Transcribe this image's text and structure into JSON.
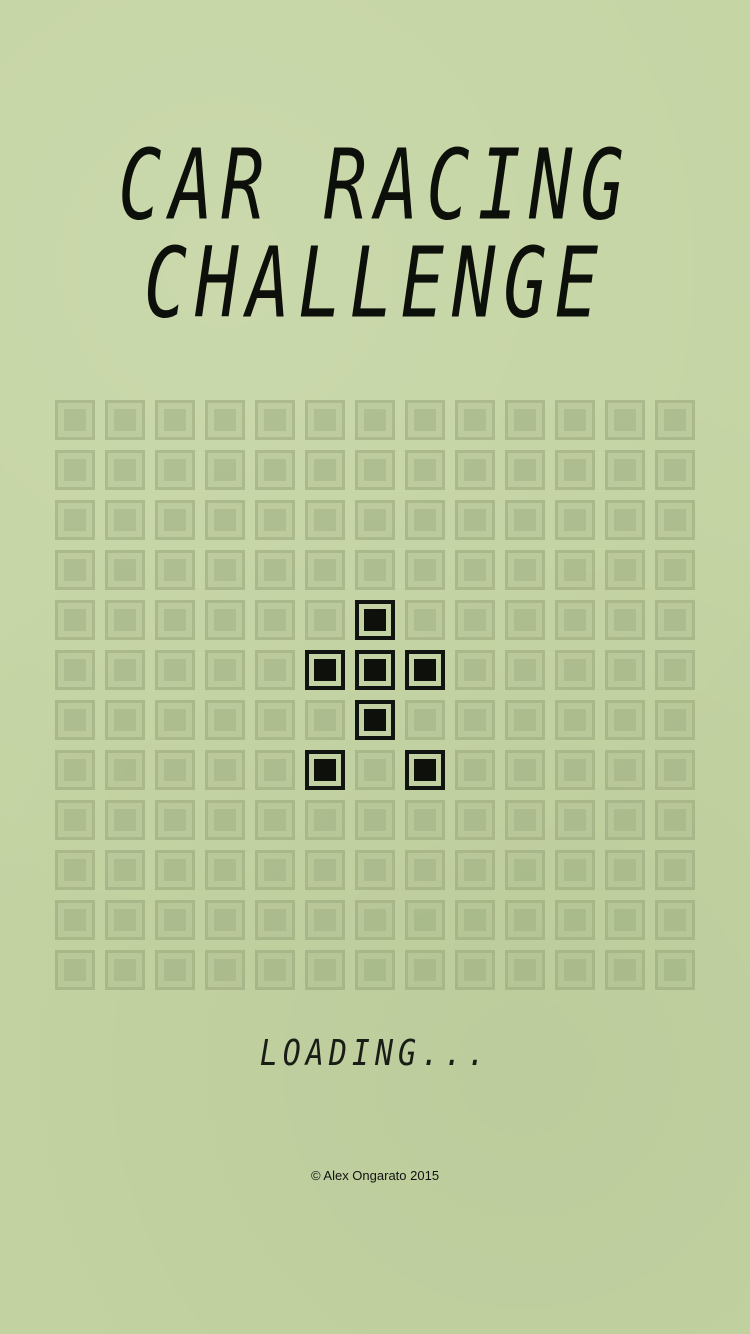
{
  "title": {
    "line1": "CAR RACING",
    "line2": "CHALLENGE"
  },
  "grid": {
    "columns": 13,
    "rows": 12,
    "lit_cells": [
      [
        6,
        4
      ],
      [
        5,
        5
      ],
      [
        6,
        5
      ],
      [
        7,
        5
      ],
      [
        6,
        6
      ],
      [
        5,
        7
      ],
      [
        7,
        7
      ]
    ]
  },
  "status": {
    "loading_text": "LOADING..."
  },
  "footer": {
    "copyright": "© Alex Ongarato 2015"
  },
  "colors": {
    "background": "#c4d4a2",
    "lcd_on": "#0d100b"
  }
}
